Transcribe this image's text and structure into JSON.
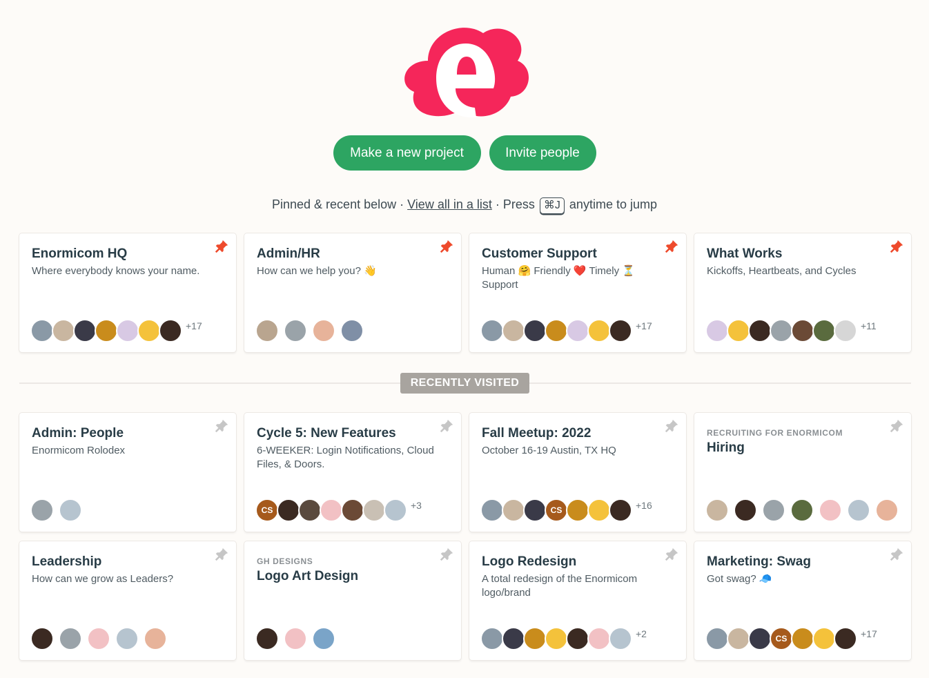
{
  "brand": {
    "logo": "enormicom-cloud-e-logo",
    "accent": "#f5265a"
  },
  "actions": {
    "new_project": "Make a new project",
    "invite": "Invite people",
    "color": "#2da562"
  },
  "hint": {
    "prefix": "Pinned & recent below ·",
    "link": "View all in a list",
    "middle": "· Press",
    "shortcut": "⌘J",
    "suffix": "anytime to jump"
  },
  "section_label": "RECENTLY VISITED",
  "pin_colors": {
    "pinned": "#ee4a2c",
    "unpinned": "#c6c6c6"
  },
  "pinned": [
    {
      "title": "Enormicom HQ",
      "desc": "Where everybody knows your name.",
      "pinned": true,
      "avatars": [
        "#8a99a6",
        "#c9b6a0",
        "#3a3a48",
        "#c98c1c",
        "#d8c9e4",
        "#f4c23b",
        "#3b2a22"
      ],
      "more": "+17"
    },
    {
      "title": "Admin/HR",
      "desc": "How can we help you? 👋",
      "pinned": true,
      "avatars": [
        "#b9a58f",
        "#9aa3a9",
        "#e7b39a",
        "#7f8fa6"
      ],
      "more": ""
    },
    {
      "title": "Customer Support",
      "desc": "Human 🤗 Friendly ❤️ Timely ⏳ Support",
      "pinned": true,
      "avatars": [
        "#8a99a6",
        "#c9b6a0",
        "#3a3a48",
        "#c98c1c",
        "#d8c9e4",
        "#f4c23b",
        "#3b2a22"
      ],
      "more": "+17"
    },
    {
      "title": "What Works",
      "desc": "Kickoffs, Heartbeats, and Cycles",
      "pinned": true,
      "avatars": [
        "#d8c9e4",
        "#f4c23b",
        "#3b2a22",
        "#9aa3a9",
        "#6b4a36",
        "#5a6b3e",
        "#d6d6d6"
      ],
      "more": "+11"
    }
  ],
  "recent_row1": [
    {
      "title": "Admin: People",
      "desc": "Enormicom Rolodex",
      "pinned": false,
      "avatars": [
        "#9aa3a9",
        "#b6c4cf"
      ],
      "more": ""
    },
    {
      "title": "Cycle 5: New Features",
      "desc": "6-WEEKER: Login Notifications, Cloud Files, & Doors.",
      "pinned": false,
      "avatars": [
        "CS:#a65a1c",
        "#3b2a22",
        "#5a4a3e",
        "#f2c1c4",
        "#6b4a36",
        "#c9c0b4",
        "#b6c4cf"
      ],
      "more": "+3"
    },
    {
      "title": "Fall Meetup: 2022",
      "desc": "October 16-19 Austin, TX HQ",
      "pinned": false,
      "avatars": [
        "#8a99a6",
        "#c9b6a0",
        "#3a3a48",
        "CS:#a65a1c",
        "#c98c1c",
        "#f4c23b",
        "#3b2a22"
      ],
      "more": "+16"
    },
    {
      "eyebrow": "RECRUITING FOR ENORMICOM",
      "title": "Hiring",
      "desc": "",
      "pinned": false,
      "avatars": [
        "#c9b6a0",
        "#3b2a22",
        "#9aa3a9",
        "#5a6b3e",
        "#f2c1c4",
        "#b6c4cf",
        "#e7b39a"
      ],
      "more": ""
    }
  ],
  "recent_row2": [
    {
      "title": "Leadership",
      "desc": "How can we grow as Leaders?",
      "pinned": false,
      "avatars": [
        "#3b2a22",
        "#9aa3a9",
        "#f2c1c4",
        "#b6c4cf",
        "#e7b39a"
      ],
      "more": ""
    },
    {
      "eyebrow": "GH DESIGNS",
      "title": "Logo Art Design",
      "desc": "",
      "pinned": false,
      "avatars": [
        "#3b2a22",
        "#f2c1c4",
        "#7aa4c8"
      ],
      "more": ""
    },
    {
      "title": "Logo Redesign",
      "desc": "A total redesign of the Enormicom logo/brand",
      "pinned": false,
      "avatars": [
        "#8a99a6",
        "#3a3a48",
        "#c98c1c",
        "#f4c23b",
        "#3b2a22",
        "#f2c1c4",
        "#b6c4cf"
      ],
      "more": "+2"
    },
    {
      "title": "Marketing: Swag",
      "desc": "Got swag? 🧢",
      "pinned": false,
      "avatars": [
        "#8a99a6",
        "#c9b6a0",
        "#3a3a48",
        "CS:#a65a1c",
        "#c98c1c",
        "#f4c23b",
        "#3b2a22"
      ],
      "more": "+17"
    }
  ]
}
